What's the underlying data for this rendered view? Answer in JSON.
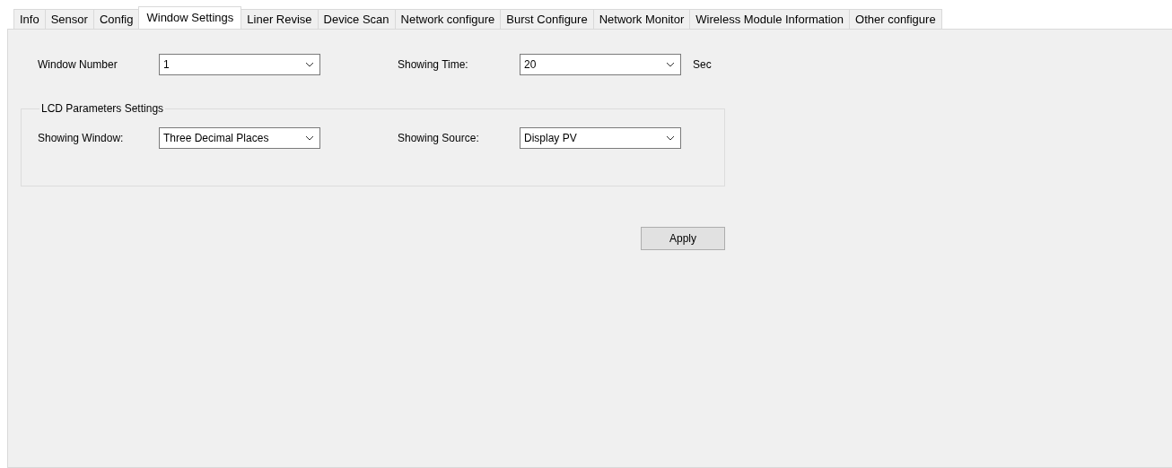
{
  "tabs": [
    {
      "label": "Info",
      "selected": false
    },
    {
      "label": "Sensor",
      "selected": false
    },
    {
      "label": "Config",
      "selected": false
    },
    {
      "label": "Window Settings",
      "selected": true
    },
    {
      "label": "Liner Revise",
      "selected": false
    },
    {
      "label": "Device Scan",
      "selected": false
    },
    {
      "label": "Network configure",
      "selected": false
    },
    {
      "label": "Burst Configure",
      "selected": false
    },
    {
      "label": "Network Monitor",
      "selected": false
    },
    {
      "label": "Wireless Module Information",
      "selected": false
    },
    {
      "label": "Other configure",
      "selected": false
    }
  ],
  "top_row": {
    "window_number": {
      "label": "Window Number",
      "value": "1"
    },
    "showing_time": {
      "label": "Showing Time:",
      "value": "20",
      "unit": "Sec"
    }
  },
  "lcd_group": {
    "title": "LCD Parameters Settings",
    "showing_window": {
      "label": "Showing Window:",
      "value": "Three Decimal Places"
    },
    "showing_source": {
      "label": "Showing Source:",
      "value": "Display PV"
    }
  },
  "apply_button": "Apply"
}
